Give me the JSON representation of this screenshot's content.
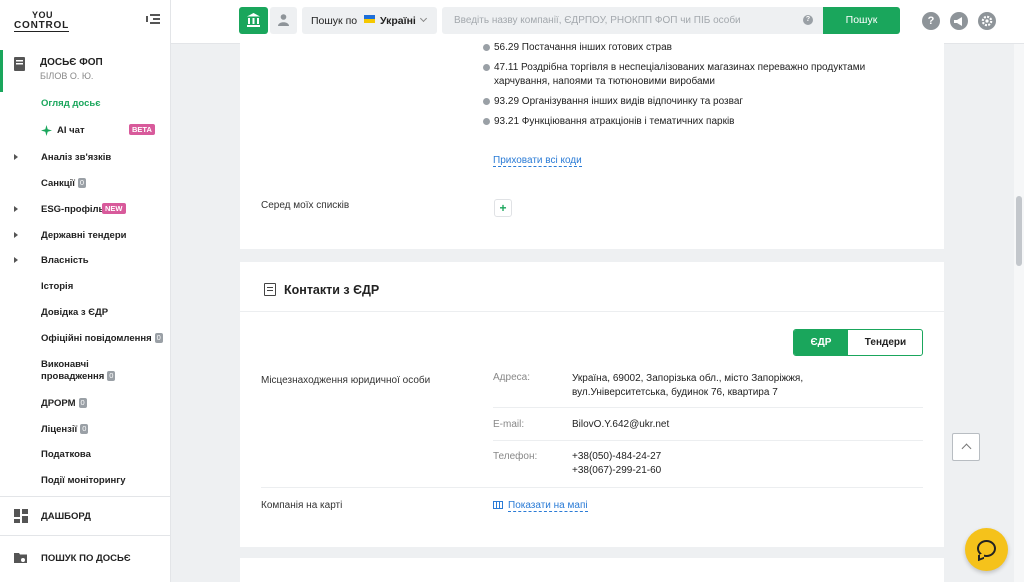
{
  "logo": {
    "line1": "YOU",
    "line2": "CONTROL"
  },
  "sidebar": {
    "dossier_title": "ДОСЬЄ ФОП",
    "dossier_subtitle": "БІЛОВ О. Ю.",
    "items": [
      {
        "label": "Огляд досьє"
      },
      {
        "label": "AI чат",
        "badge": "BETA"
      },
      {
        "label": "Аналіз зв'язків"
      },
      {
        "label": "Санкції",
        "count": "0"
      },
      {
        "label": "ESG-профіль",
        "badge": "NEW"
      },
      {
        "label": "Державні тендери"
      },
      {
        "label": "Власність"
      },
      {
        "label": "Історія"
      },
      {
        "label": "Довідка з ЄДР"
      },
      {
        "label": "Офіційні повідомлення",
        "count": "0"
      },
      {
        "label_line1": "Виконавчі",
        "label_line2": "провадження",
        "count": "0"
      },
      {
        "label": "ДРОРМ",
        "count": "0"
      },
      {
        "label": "Ліцензії",
        "count": "0"
      },
      {
        "label": "Податкова"
      },
      {
        "label": "Події моніторингу"
      }
    ],
    "dashboard_label": "ДАШБОРД",
    "search_dossier_label": "ПОШУК ПО ДОСЬЄ"
  },
  "topbar": {
    "search_scope_prefix": "Пошук по",
    "search_scope_country": "Україні",
    "search_placeholder": "Введіть назву компанії, ЄДРПОУ, РНОКПП ФОП чи ПІБ особи",
    "search_button": "Пошук",
    "help_glyph": "?"
  },
  "kved": [
    {
      "text": "56.29 Постачання інших готових страв"
    },
    {
      "text": "47.11 Роздрібна торгівля в неспеціалізованих магазинах переважно продуктами харчування, напоями та тютюновими виробами"
    },
    {
      "text": "93.29 Організування інших видів відпочинку та розваг"
    },
    {
      "text": "93.21 Функціювання атракціонів і тематичних парків"
    }
  ],
  "hide_codes_link": "Приховати всі коди",
  "my_lists_label": "Серед моїх списків",
  "plus_glyph": "+",
  "contacts": {
    "title": "Контакти з ЄДР",
    "toggle_edr": "ЄДР",
    "toggle_tenders": "Тендери",
    "location_label": "Місцезнаходження юридичної особи",
    "address_label": "Адреса:",
    "address_line1": "Україна, 69002, Запорізька обл., місто Запоріжжя,",
    "address_line2": "вул.Університетська, будинок 76, квартира 7",
    "email_label": "E-mail:",
    "email_value": "BilovO.Y.642@ukr.net",
    "phone_label": "Телефон:",
    "phone1": "+38(050)-484-24-27",
    "phone2": "+38(067)-299-21-60",
    "map_label": "Компанія на карті",
    "map_link": "Показати на мапі"
  },
  "colors": {
    "brand_green": "#1aa65c",
    "link_blue": "#2a7bd6",
    "badge_pink": "#d85a9b",
    "chat_yellow": "#f5c21b"
  },
  "icons": [
    "menu-collapse-icon",
    "dossier-icon",
    "sparkle-icon",
    "institution-icon",
    "person-icon",
    "question-icon",
    "megaphone-icon",
    "gear-icon",
    "document-icon",
    "map-icon",
    "arrow-up-icon",
    "chat-icon",
    "dashboard-icon",
    "search-dossier-icon"
  ]
}
